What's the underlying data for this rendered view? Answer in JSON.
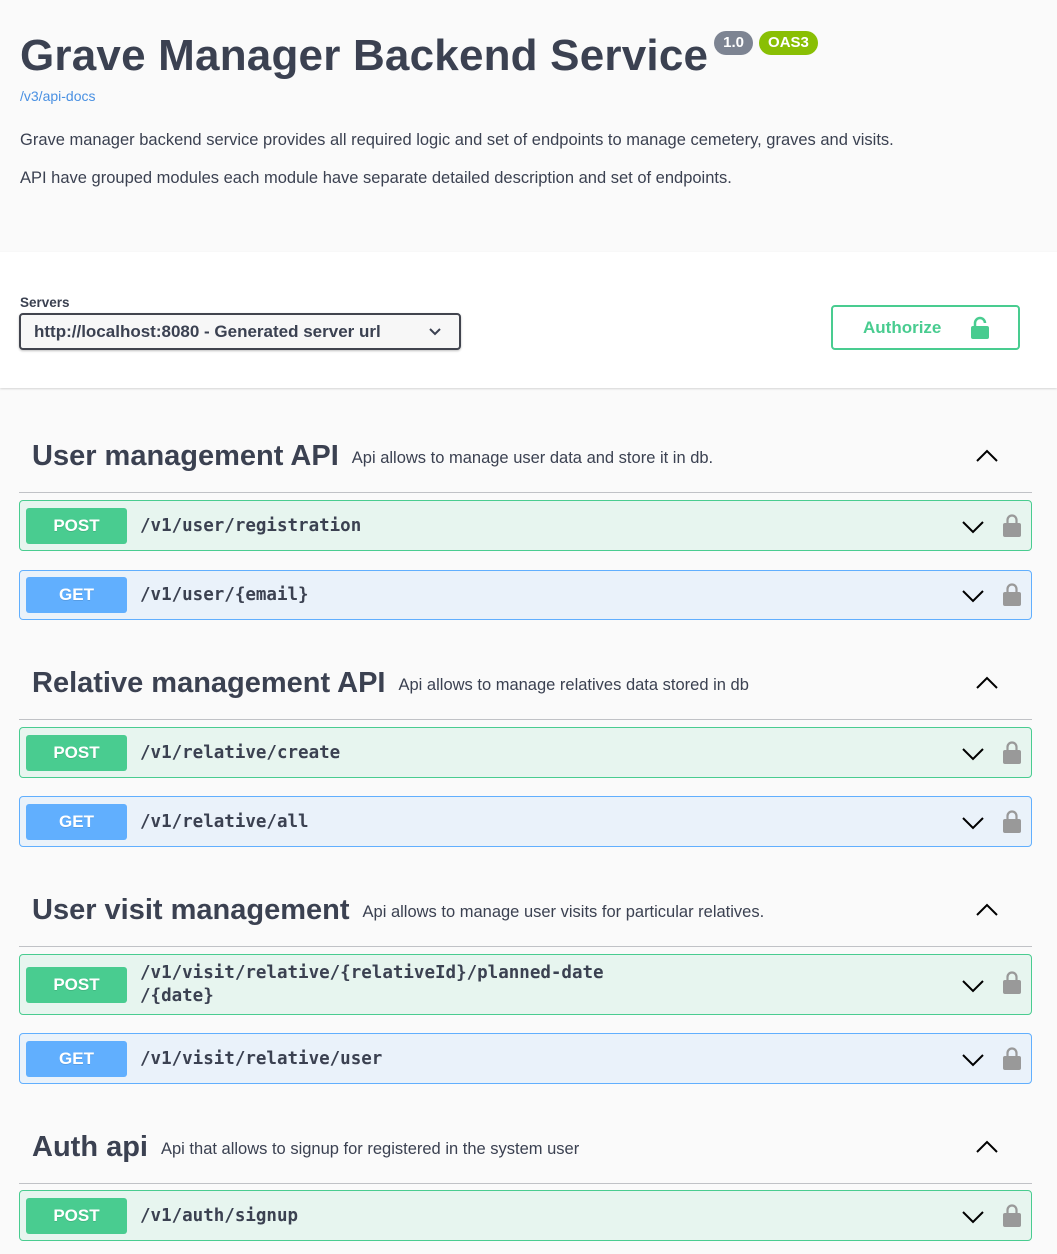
{
  "info": {
    "title": "Grave Manager Backend Service",
    "version": "1.0",
    "oas": "OAS3",
    "api_docs_link": "/v3/api-docs",
    "description_1": "Grave manager backend service provides all required logic and set of endpoints to manage cemetery, graves and visits.",
    "description_2": "API have grouped modules each module have separate detailed description and set of endpoints."
  },
  "servers": {
    "label": "Servers",
    "selected": "http://localhost:8080 - Generated server url"
  },
  "authorize_label": "Authorize",
  "colors": {
    "post": "#49cc90",
    "get": "#61affe",
    "text": "#3b4151"
  },
  "tags": [
    {
      "name": "User management API",
      "description": "Api allows to manage user data and store it in db.",
      "operations": [
        {
          "method": "POST",
          "path": "/v1/user/registration"
        },
        {
          "method": "GET",
          "path": "/v1/user/{email}"
        }
      ]
    },
    {
      "name": "Relative management API",
      "description": "Api allows to manage relatives data stored in db",
      "operations": [
        {
          "method": "POST",
          "path": "/v1/relative/create"
        },
        {
          "method": "GET",
          "path": "/v1/relative/all"
        }
      ]
    },
    {
      "name": "User visit management",
      "description": "Api allows to manage user visits for particular relatives.",
      "operations": [
        {
          "method": "POST",
          "path_line1": "/v1/visit/relative/{relativeId}/planned-date",
          "path_line2": "/{date}"
        },
        {
          "method": "GET",
          "path": "/v1/visit/relative/user"
        }
      ]
    },
    {
      "name": "Auth api",
      "description": "Api that allows to signup for registered in the system user",
      "operations": [
        {
          "method": "POST",
          "path": "/v1/auth/signup"
        }
      ]
    }
  ]
}
